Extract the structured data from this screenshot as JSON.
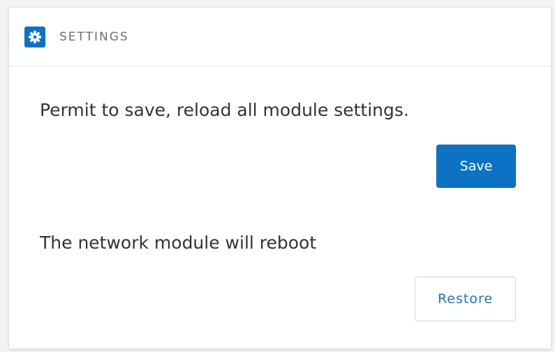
{
  "header": {
    "icon": "gear-icon",
    "title": "SETTINGS"
  },
  "save_section": {
    "description": "Permit to save, reload all module settings.",
    "button_label": "Save"
  },
  "restore_section": {
    "description": "The network module will reboot",
    "button_label": "Restore"
  },
  "colors": {
    "accent": "#0d72c3",
    "secondary_text": "#1f73b8"
  }
}
